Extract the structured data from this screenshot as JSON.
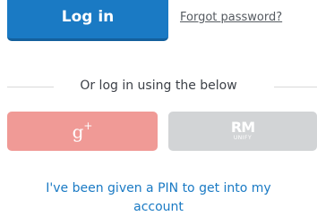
{
  "login": {
    "button_label": "Log in",
    "forgot_password": "Forgot password?"
  },
  "divider": {
    "text": "Or log in using the below"
  },
  "social": {
    "google_icon": "google-plus-icon",
    "google_label": "g",
    "google_sup": "+",
    "rm_icon": "rm-unify-logo",
    "rm_mark": "RM",
    "rm_sub": "UNIFY",
    "google_color": "#f09a96",
    "rm_color": "#d2d4d6"
  },
  "pin": {
    "line1": "I've been given a PIN to get into my",
    "line2": "account"
  },
  "colors": {
    "primary": "#1a7ac4",
    "text": "#3d4148",
    "link": "#555a60"
  }
}
